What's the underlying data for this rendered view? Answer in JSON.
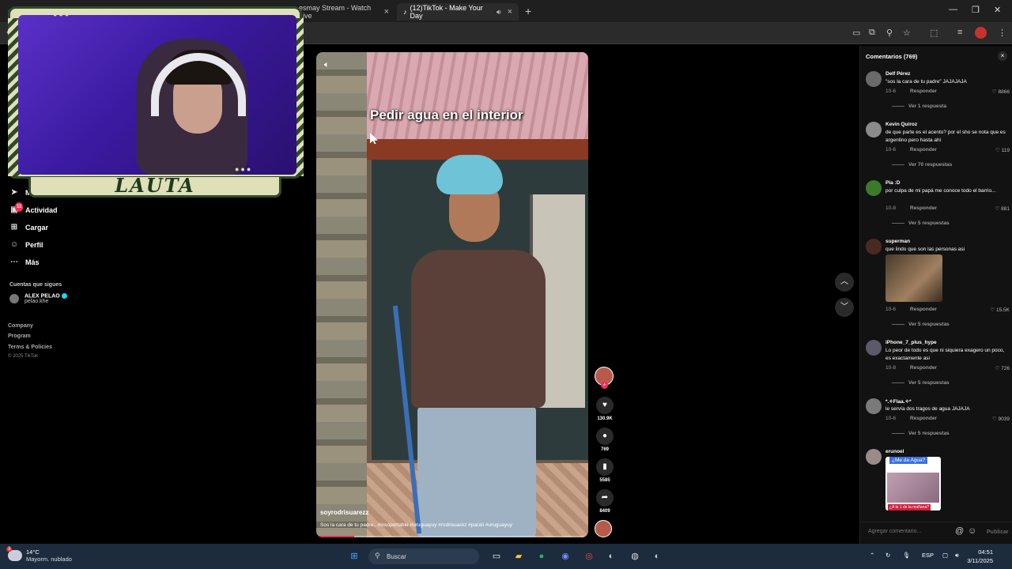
{
  "browser": {
    "tabs": [
      {
        "label": "esmay Stream - Watch Live",
        "active": false
      },
      {
        "label": "(12)TikTok - Make Your Day",
        "active": true
      }
    ]
  },
  "sidebar": {
    "items": [
      {
        "label": "M",
        "icon": "send-icon"
      },
      {
        "label": "Actividad",
        "icon": "activity-icon",
        "badge": "11"
      },
      {
        "label": "Cargar",
        "icon": "upload-icon"
      },
      {
        "label": "Perfil",
        "icon": "profile-icon"
      },
      {
        "label": "Más",
        "icon": "more-icon"
      }
    ],
    "following_title": "Cuentas que sigues",
    "following": [
      {
        "name": "ALEX PELAO",
        "handle": "pelao.khe",
        "verified": true
      }
    ],
    "footer": [
      "Company",
      "Program",
      "Terms & Policies"
    ],
    "copyright": "© 2025 TikTok"
  },
  "webcam": {
    "banner": "LAUTA"
  },
  "video": {
    "caption_overlay": "Pedir agua en el interior",
    "author": "soyrodrisuarezz",
    "description": "Sos la cara de tu padre...#insoportable #uruguayuy #rodrisuarez #parati #uruguayuy",
    "progress": 0.14
  },
  "actions": {
    "likes": "130.9K",
    "comments": "769",
    "saves": "5585",
    "shares": "8409"
  },
  "comments_panel": {
    "title": "Comentarios (769)",
    "reply_label": "Responder",
    "input_placeholder": "Agregar comentario...",
    "publish_label": "Publicar",
    "items": [
      {
        "user": "Delf Pérez",
        "text": "\"sos la cara de tu padre\" JAJAJAJA",
        "date": "10-6",
        "likes": "8866",
        "more": "Ver 1 respuesta"
      },
      {
        "user": "Kevin Quiroz",
        "text": "de que parte es el acento? por el sho se nota que es argentino pero hasta ahí",
        "date": "10-6",
        "likes": "119",
        "more": "Ver 70 respuestas"
      },
      {
        "user": "Pia :D",
        "text": "por culpa de mi papá me conoce todo el barrio...",
        "date": "10-8",
        "likes": "881",
        "more": "Ver 5 respuestas"
      },
      {
        "user": "superman",
        "text": "que lindo que son las personas asi",
        "date": "10-6",
        "likes": "15.5K",
        "more": "Ver 5 respuestas"
      },
      {
        "user": "iPhone_7_plus_hype",
        "text": "Lo peor de todo es que ni siquiera exagero un poco, es exactamente asi",
        "date": "10-8",
        "likes": "726",
        "more": "Ver 5 respuestas"
      },
      {
        "user": "*.✧Flaa.✧*",
        "text": "le servía dos tragos de agua JAJAJA",
        "date": "10-6",
        "likes": "9039",
        "more": "Ver 5 respuestas"
      },
      {
        "user": "erunoel",
        "sticker_top": "¿Me da Agua?",
        "sticker_bottom": "¿A la 1 de la mañana?"
      }
    ]
  },
  "taskbar": {
    "temp": "14°C",
    "weather": "Mayorm. nublado",
    "weather_badge": "3",
    "search": "Buscar",
    "lang": "ESP",
    "time": "04:51",
    "date": "3/11/2025"
  }
}
